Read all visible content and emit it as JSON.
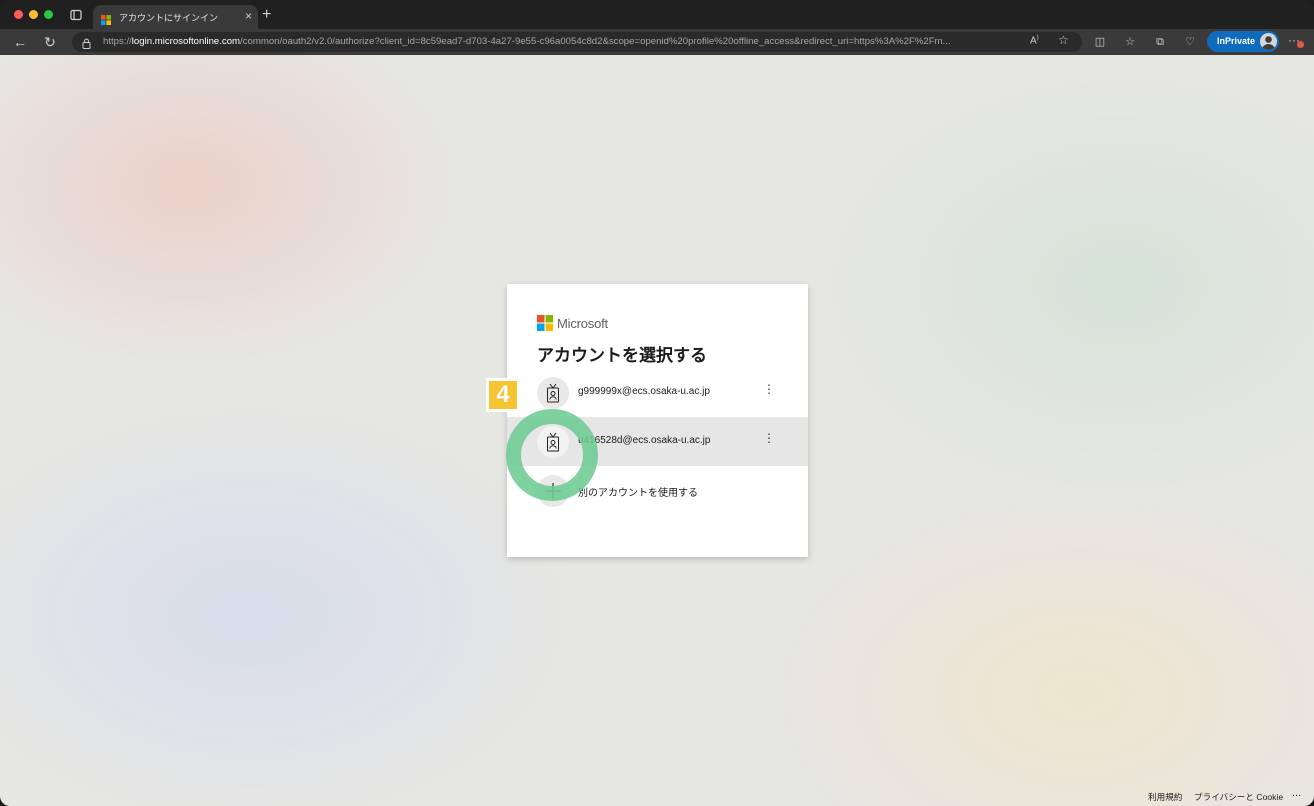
{
  "browser": {
    "tab_title": "アカウントにサインイン",
    "url_prefix": "https://",
    "url_host": "login.microsoftonline.com",
    "url_path": "/common/oauth2/v2.0/authorize?client_id=8c59ead7-d703-4a27-9e55-c96a0054c8d2&scope=openid%20profile%20offline_access&redirect_uri=https%3A%2F%2Fm...",
    "inprivate_label": "InPrivate"
  },
  "login": {
    "brand": "Microsoft",
    "title": "アカウントを選択する",
    "accounts": [
      {
        "email": "g999999x@ecs.osaka-u.ac.jp"
      },
      {
        "email": "u416528d@ecs.osaka-u.ac.jp"
      }
    ],
    "use_another": "別のアカウントを使用する"
  },
  "annotation": {
    "step_number": "4"
  },
  "footer": {
    "terms": "利用規約",
    "privacy": "プライバシーと Cookie",
    "more": "..."
  },
  "colors": {
    "accent": "#0f6cbd",
    "highlight_ring": "#6ecb93",
    "step_badge": "#f6c431"
  }
}
